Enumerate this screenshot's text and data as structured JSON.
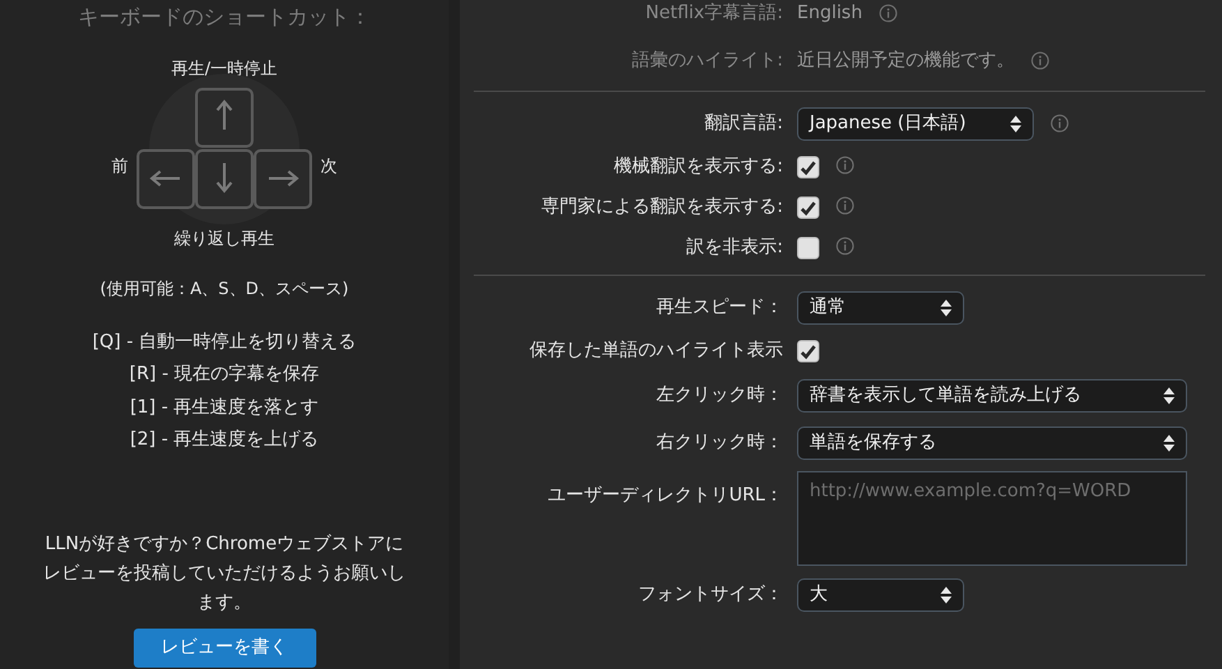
{
  "shortcuts_panel": {
    "title": "キーボードのショートカット：",
    "key_up_label": "再生/一時停止",
    "key_left_label": "前",
    "key_right_label": "次",
    "key_down_label": "繰り返し再生",
    "alternatives": "(使用可能：A、S、D、スペース)",
    "shortcuts": [
      "[Q] - 自動一時停止を切り替える",
      "[R] - 現在の字幕を保存",
      "[1] - 再生速度を落とす",
      "[2] - 再生速度を上げる"
    ],
    "review_prompt": "LLNが好きですか？Chromeウェブストアにレビューを投稿していただけるようお願いします。",
    "review_button": "レビューを書く"
  },
  "settings": {
    "sections": [
      [
        {
          "kind": "info",
          "label": "Netflix字幕言語:",
          "value": "English",
          "info": true
        },
        {
          "kind": "info",
          "label": "語彙のハイライト:",
          "value": "近日公開予定の機能です。",
          "info": true
        }
      ],
      [
        {
          "kind": "select",
          "label": "翻訳言語:",
          "value": "Japanese (日本語)",
          "info": true
        },
        {
          "kind": "checkbox",
          "label": "機械翻訳を表示する:",
          "checked": true,
          "info": true
        },
        {
          "kind": "checkbox",
          "label": "専門家による翻訳を表示する:",
          "checked": true,
          "info": true
        },
        {
          "kind": "checkbox",
          "label": "訳を非表示:",
          "checked": false,
          "info": true
        }
      ],
      [
        {
          "kind": "select",
          "label": "再生スピード：",
          "value": "通常",
          "info": false
        },
        {
          "kind": "checkbox",
          "label": "保存した単語のハイライト表示",
          "checked": true,
          "info": false
        },
        {
          "kind": "select",
          "label": "左クリック時：",
          "value": "辞書を表示して単語を読み上げる",
          "info": false
        },
        {
          "kind": "select",
          "label": "右クリック時：",
          "value": "単語を保存する",
          "info": false
        },
        {
          "kind": "textarea",
          "label": "ユーザーディレクトリURL：",
          "placeholder": "http://www.example.com?q=WORD",
          "info": false
        },
        {
          "kind": "select",
          "label": "フォントサイズ：",
          "value": "大",
          "info": false
        }
      ]
    ]
  }
}
